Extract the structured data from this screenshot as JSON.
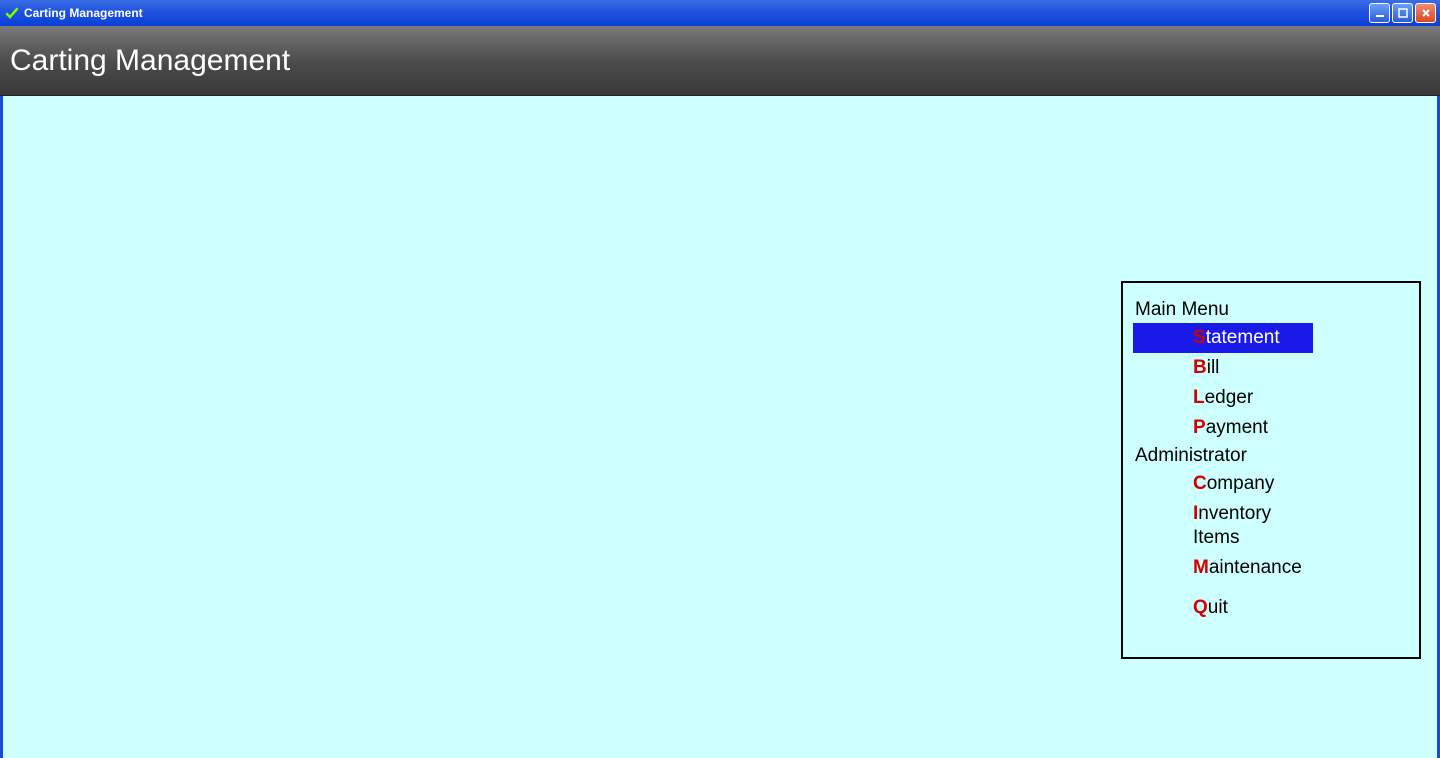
{
  "window": {
    "title": "Carting Management"
  },
  "header": {
    "title": "Carting Management"
  },
  "menu": {
    "sections": [
      {
        "label": "Main Menu",
        "items": [
          {
            "hotkey": "S",
            "rest": "tatement",
            "selected": true
          },
          {
            "hotkey": "B",
            "rest": "ill",
            "selected": false
          },
          {
            "hotkey": "L",
            "rest": "edger",
            "selected": false
          },
          {
            "hotkey": "P",
            "rest": "ayment",
            "selected": false
          }
        ]
      },
      {
        "label": "Administrator",
        "items": [
          {
            "hotkey": "C",
            "rest": "ompany",
            "selected": false
          },
          {
            "hotkey": "I",
            "rest": "nventory Items",
            "selected": false
          },
          {
            "hotkey": "M",
            "rest": "aintenance",
            "selected": false
          }
        ]
      }
    ],
    "quit": {
      "hotkey": "Q",
      "rest": "uit"
    }
  }
}
